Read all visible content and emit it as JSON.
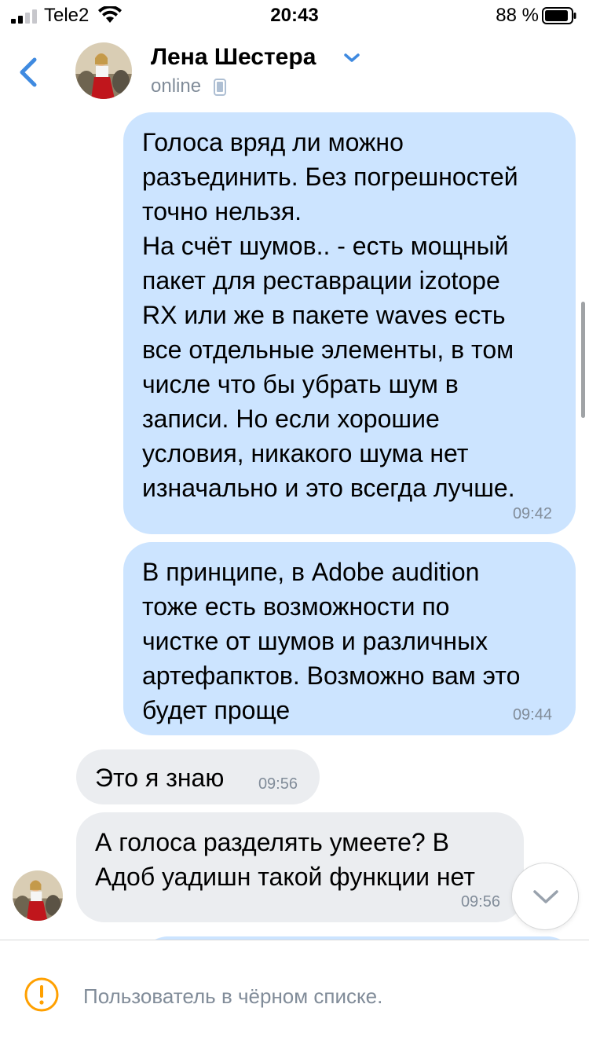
{
  "status_bar": {
    "carrier": "Tele2",
    "time": "20:43",
    "battery_percent": "88 %"
  },
  "header": {
    "contact_name": "Лена Шестера",
    "contact_status": "online"
  },
  "messages": [
    {
      "direction": "out",
      "text": "Голоса вряд ли можно\nразъединить. Без погрешностей\nточно нельзя.\nНа счёт шумов.. - есть мощный\nпакет для реставрации izotope\nRX или же в пакете waves есть\nвсе отдельные элементы, в том\nчисле что бы убрать шум в\nзаписи. Но если хорошие\nусловия, никакого шума нет\nизначально и это всегда лучше.",
      "time": "09:42"
    },
    {
      "direction": "out",
      "text": "В принципе, в Adobe audition\nтоже есть возможности по\nчистке от шумов и различных\nартефапктов. Возможно вам это\nбудет проще",
      "time": "09:44"
    },
    {
      "direction": "in",
      "text": "Это я знаю",
      "time": "09:56"
    },
    {
      "direction": "in",
      "text": "А голоса разделять умеете? В\nАдоб уадишн такой функции нет",
      "time": "09:56"
    }
  ],
  "footer": {
    "notice": "Пользователь в чёрном списке."
  },
  "colors": {
    "accent": "#3f8ae0",
    "outgoing_bubble": "#cce4ff",
    "incoming_bubble": "#ebedf0",
    "secondary_text": "#818c99",
    "warning": "#ffa000"
  },
  "icons": {
    "back": "chevron-left-icon",
    "name_dropdown": "chevron-down-icon",
    "device": "phone-icon",
    "scroll_down": "chevron-down-icon",
    "footer": "warning-icon"
  }
}
